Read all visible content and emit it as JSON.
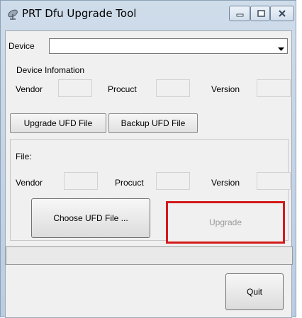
{
  "window": {
    "title": "PRT Dfu Upgrade Tool",
    "icon": "satellite-dish-icon"
  },
  "device": {
    "label": "Device",
    "selected_value": ""
  },
  "device_info": {
    "group_title": "Device Infomation",
    "vendor_label": "Vendor",
    "product_label": "Procuct",
    "version_label": "Version"
  },
  "tabs": [
    {
      "label": "Upgrade UFD File",
      "selected": true
    },
    {
      "label": "Backup UFD File",
      "selected": false
    }
  ],
  "file": {
    "title": "File:",
    "vendor_label": "Vendor",
    "product_label": "Procuct",
    "version_label": "Version"
  },
  "actions": {
    "choose_label": "Choose UFD File ...",
    "upgrade_label": "Upgrade",
    "quit_label": "Quit"
  },
  "colors": {
    "highlight": "#d31a1a",
    "disabled_text": "#9a9a9a"
  }
}
